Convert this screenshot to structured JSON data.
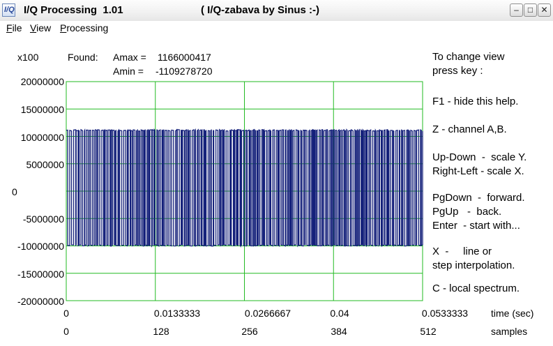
{
  "window": {
    "title": "I/Q Processing  1.01",
    "subtitle": "( I/Q-zabava by Sinus :-)",
    "icon": "app-iq-icon",
    "icon_text": "I/Q",
    "minimize": "–",
    "maximize": "□",
    "close": "✕"
  },
  "menu": [
    "File",
    "View",
    "Processing"
  ],
  "plot": {
    "scale_label": "x100",
    "found_label": "Found:",
    "amax_label": "Amax =",
    "amax_value": "1166000417",
    "amin_label": "Amin =",
    "amin_value": "-1109278720",
    "x_unit_time": "time (sec)",
    "x_unit_samples": "samples",
    "grid_color": "#22bb22",
    "signal_color": "#14207a"
  },
  "chart_data": {
    "type": "line",
    "title": "",
    "ylabel": "x100",
    "xlabel": "time (sec)",
    "ylim": [
      -20000000,
      20000000
    ],
    "xlim": [
      0,
      512
    ],
    "grid": true,
    "y_ticks": [
      "20000000",
      "15000000",
      "10000000",
      "5000000",
      "0",
      "-5000000",
      "-10000000",
      "-15000000",
      "-20000000"
    ],
    "x_ticks_time": [
      "0",
      "0.0133333",
      "0.0266667",
      "0.04",
      "0.0533333"
    ],
    "x_ticks_samples": [
      "0",
      "128",
      "256",
      "384",
      "512"
    ],
    "series": [
      {
        "high": 11100000,
        "low": -9900000,
        "x_range": [
          0,
          512
        ]
      }
    ]
  },
  "help": {
    "lines": [
      "To change view",
      "press key :",
      "F1 - hide this help.",
      "Z - channel A,B.",
      "Up-Down  -  scale Y.",
      "Right-Left - scale X.",
      "PgDown  -  forward.",
      "PgUp   -  back.",
      "Enter  - start with...",
      "X  -     line or",
      "step interpolation.",
      "C - local spectrum."
    ]
  }
}
